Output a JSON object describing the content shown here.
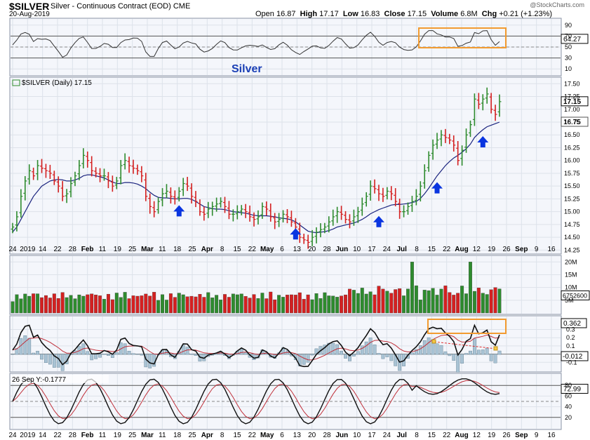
{
  "header": {
    "symbol": "$SILVER",
    "description": "Silver - Continuous Contract (EOD)",
    "exchange": "CME",
    "date": "20-Aug-2019",
    "open_label": "Open",
    "open": "16.87",
    "high_label": "High",
    "high": "17.17",
    "low_label": "Low",
    "low": "16.83",
    "close_label": "Close",
    "close": "17.15",
    "volume_label": "Volume",
    "volume": "6.8M",
    "chg_label": "Chg",
    "chg": "+0.21 (+1.23%)",
    "watermark": "@StockCharts.com"
  },
  "chart_data": [
    {
      "type": "line",
      "panel": "rsi-top",
      "yticks": [
        10,
        30,
        50,
        70,
        90
      ],
      "last_value": "64.27",
      "ylim": [
        0,
        100
      ],
      "annotation_box": "orange"
    },
    {
      "type": "candlestick",
      "panel": "price",
      "title": "Silver",
      "legend": "$SILVER (Daily) 17.15",
      "yticks": [
        "14.25",
        "14.50",
        "14.75",
        "15.00",
        "15.25",
        "15.50",
        "15.75",
        "16.00",
        "16.25",
        "16.50",
        "16.75",
        "17.00",
        "17.25",
        "17.50"
      ],
      "ylim": [
        14.2,
        17.6
      ],
      "last_close": "17.15",
      "ma_value": "16.75",
      "x_labels": [
        "24",
        "2019",
        "14",
        "22",
        "28",
        "Feb",
        "11",
        "19",
        "25",
        "Mar",
        "11",
        "18",
        "25",
        "Apr",
        "8",
        "15",
        "22",
        "May",
        "6",
        "13",
        "20",
        "28",
        "Jun",
        "10",
        "17",
        "24",
        "Jul",
        "8",
        "15",
        "22",
        "Aug",
        "12",
        "19",
        "26",
        "Sep",
        "9",
        "16"
      ],
      "closes": [
        14.7,
        14.9,
        15.3,
        15.6,
        15.8,
        15.7,
        15.9,
        15.85,
        15.8,
        15.75,
        15.6,
        15.5,
        15.3,
        15.35,
        15.55,
        15.7,
        15.9,
        16.1,
        16.0,
        15.8,
        15.75,
        15.7,
        15.7,
        15.6,
        15.5,
        15.6,
        15.9,
        16.0,
        15.9,
        15.85,
        15.8,
        15.7,
        15.3,
        15.1,
        15.0,
        15.2,
        15.35,
        15.4,
        15.3,
        15.25,
        15.4,
        15.55,
        15.5,
        15.3,
        15.2,
        15.0,
        14.95,
        15.05,
        15.1,
        15.15,
        15.2,
        15.1,
        14.95,
        14.95,
        15.0,
        15.05,
        15.0,
        14.9,
        14.85,
        14.9,
        15.1,
        15.05,
        14.9,
        14.8,
        14.85,
        14.95,
        14.9,
        14.8,
        14.7,
        14.5,
        14.45,
        14.4,
        14.5,
        14.6,
        14.65,
        14.7,
        14.8,
        14.9,
        15.0,
        14.95,
        14.85,
        14.8,
        14.9,
        15.0,
        15.15,
        15.3,
        15.5,
        15.45,
        15.35,
        15.3,
        15.4,
        15.35,
        15.2,
        15.0,
        15.0,
        15.1,
        15.2,
        15.3,
        15.5,
        15.8,
        16.1,
        16.3,
        16.4,
        16.5,
        16.45,
        16.4,
        16.3,
        16.0,
        16.2,
        16.5,
        16.7,
        17.2,
        17.1,
        17.2,
        17.3,
        17.0,
        16.9,
        17.15
      ],
      "ma": [
        14.6,
        14.7,
        14.85,
        15.0,
        15.15,
        15.3,
        15.4,
        15.5,
        15.55,
        15.6,
        15.62,
        15.63,
        15.62,
        15.6,
        15.6,
        15.62,
        15.65,
        15.7,
        15.72,
        15.72,
        15.7,
        15.68,
        15.66,
        15.62,
        15.58,
        15.55,
        15.55,
        15.57,
        15.57,
        15.56,
        15.54,
        15.5,
        15.45,
        15.38,
        15.32,
        15.28,
        15.27,
        15.27,
        15.26,
        15.25,
        15.25,
        15.26,
        15.26,
        15.24,
        15.2,
        15.15,
        15.1,
        15.08,
        15.06,
        15.05,
        15.05,
        15.04,
        15.02,
        15.0,
        14.99,
        14.98,
        14.97,
        14.95,
        14.93,
        14.92,
        14.92,
        14.92,
        14.91,
        14.9,
        14.88,
        14.87,
        14.86,
        14.84,
        14.8,
        14.74,
        14.68,
        14.62,
        14.6,
        14.59,
        14.6,
        14.61,
        14.63,
        14.66,
        14.7,
        14.72,
        14.74,
        14.76,
        14.78,
        14.81,
        14.85,
        14.9,
        14.96,
        15.0,
        15.04,
        15.07,
        15.1,
        15.13,
        15.14,
        15.14,
        15.15,
        15.16,
        15.18,
        15.2,
        15.26,
        15.35,
        15.46,
        15.58,
        15.7,
        15.8,
        15.9,
        15.98,
        16.05,
        16.1,
        16.16,
        16.23,
        16.32,
        16.45,
        16.53,
        16.6,
        16.66,
        16.69,
        16.72,
        16.75
      ],
      "arrows": [
        22,
        37,
        48,
        56,
        62
      ]
    },
    {
      "type": "bar",
      "panel": "volume",
      "yticks": [
        "5M",
        "10M",
        "15M",
        "20M"
      ],
      "last_value": "6752600",
      "ylim": [
        0,
        22000000
      ]
    },
    {
      "type": "line",
      "panel": "macd",
      "yticks": [
        "0.3",
        "0.2",
        "0.1",
        "-0.1"
      ],
      "macd_value": "0.362",
      "hist_value": "-0.012",
      "annotation_box": "orange"
    },
    {
      "type": "line",
      "panel": "stochastic",
      "legend": "26 Sep Y:-0.1777",
      "yticks": [
        "80",
        "60",
        "40",
        "20"
      ],
      "last_value": "72.99",
      "x_labels": [
        "24",
        "2019",
        "14",
        "22",
        "28",
        "Feb",
        "11",
        "19",
        "25",
        "Mar",
        "11",
        "18",
        "25",
        "Apr",
        "8",
        "15",
        "22",
        "May",
        "6",
        "13",
        "20",
        "28",
        "Jun",
        "10",
        "17",
        "24",
        "Jul",
        "8",
        "15",
        "22",
        "Aug",
        "12",
        "19",
        "26",
        "Sep",
        "9",
        "16"
      ]
    }
  ],
  "colors": {
    "up": "#2e8b2e",
    "down": "#d42020",
    "ma": "#1a237e",
    "arrow": "#0a35e0",
    "box": "#f29b30",
    "grid": "#dde2ea",
    "bg": "#f4f6fb"
  }
}
